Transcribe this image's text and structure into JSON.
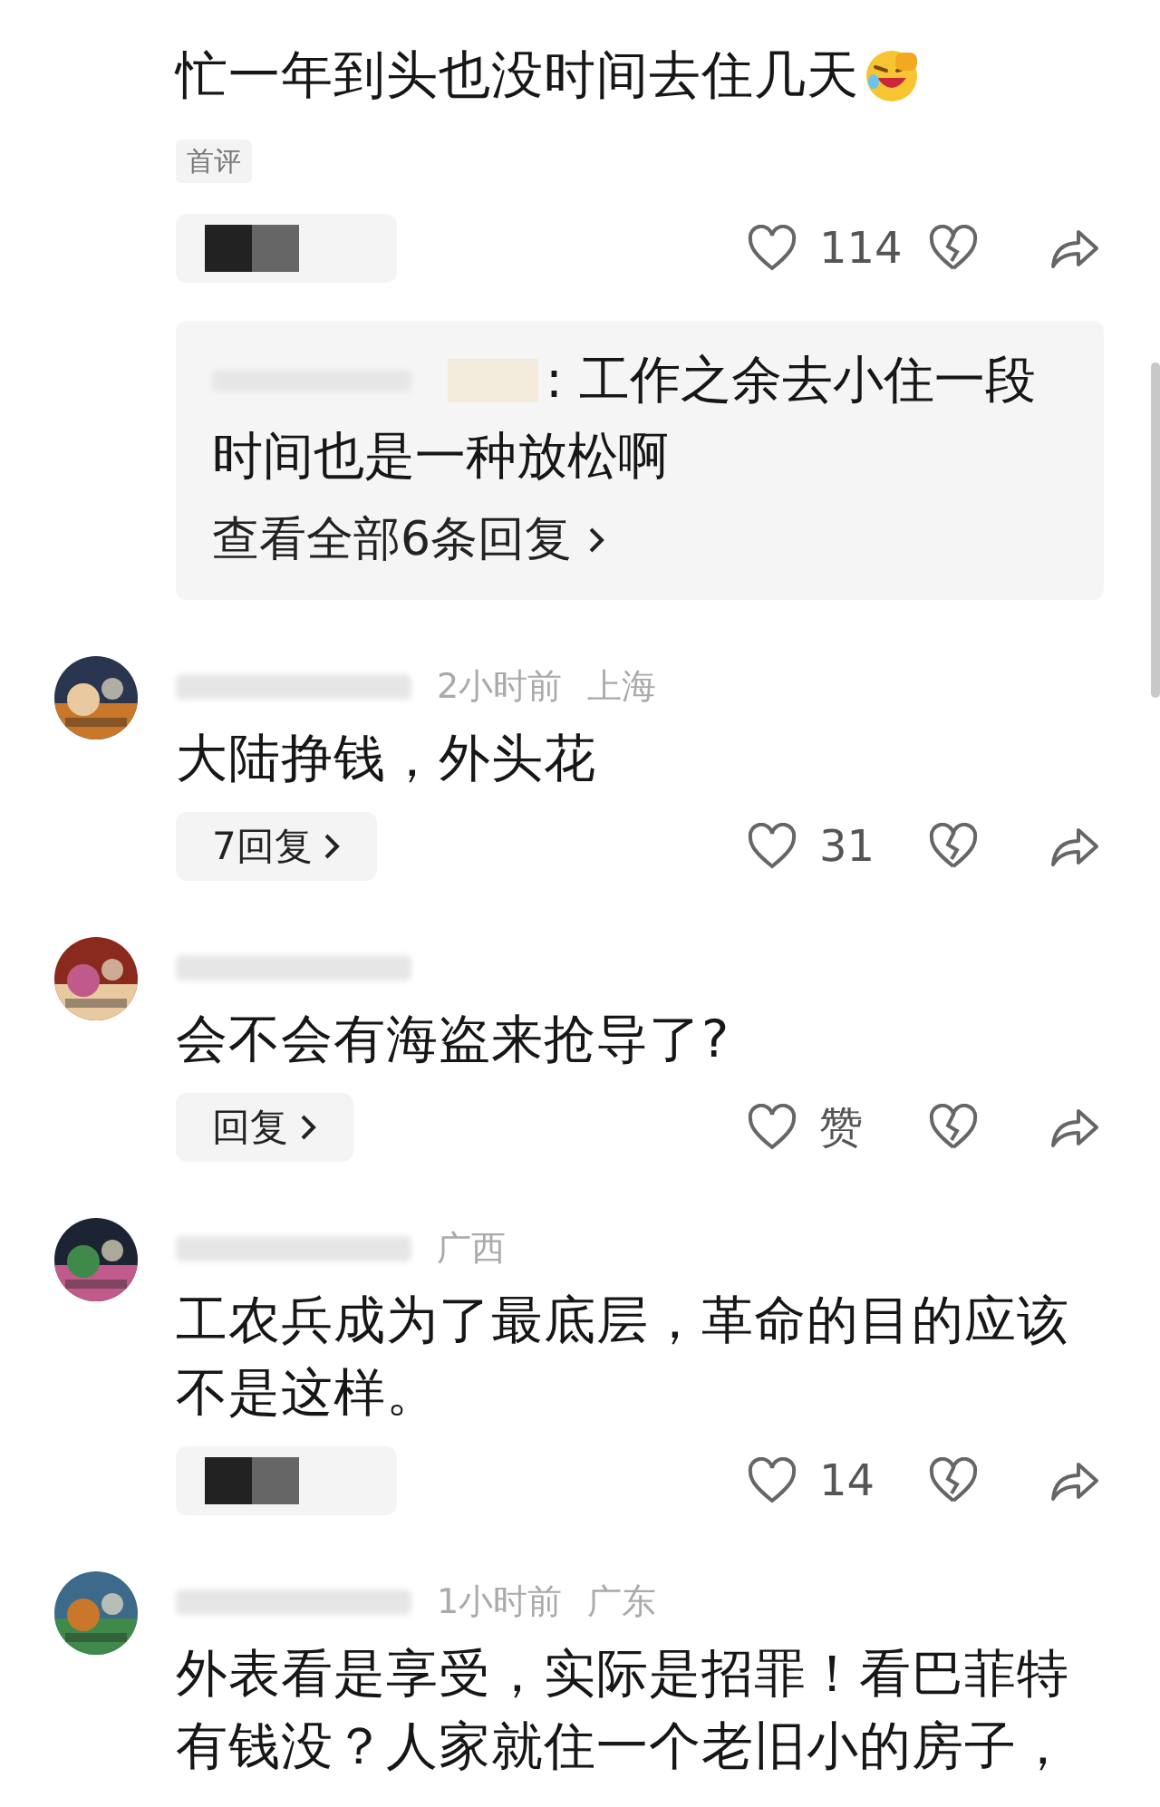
{
  "comments": [
    {
      "text": "忙一年到头也没时间去住几天",
      "emoji": true,
      "tag": "首评",
      "reply": {
        "kind": "redacted"
      },
      "likes": "114",
      "thread": {
        "lines": [
          ": 工作之余去小住一段",
          "时间也是一种放松啊"
        ],
        "more": "查看全部6条回复"
      }
    },
    {
      "avatar": {
        "kind": "picture"
      },
      "meta": [
        {
          "kind": "redacted"
        },
        {
          "kind": "text",
          "text": "2小时前"
        },
        {
          "kind": "text",
          "text": "上海"
        }
      ],
      "text": "大陆挣钱，外头花",
      "reply": {
        "kind": "button",
        "label": "7回复"
      },
      "likes": "31"
    },
    {
      "avatar": {
        "kind": "picture"
      },
      "meta": [
        {
          "kind": "redacted"
        }
      ],
      "text": "会不会有海盗来抢导了?",
      "reply": {
        "kind": "button",
        "label": "回复"
      },
      "likes": "赞"
    },
    {
      "avatar": {
        "kind": "picture"
      },
      "meta": [
        {
          "kind": "redacted"
        },
        {
          "kind": "text",
          "text": "广西"
        }
      ],
      "text": "工农兵成为了最底层，革命的目的应该不是这样。",
      "reply": {
        "kind": "redacted"
      },
      "likes": "14"
    },
    {
      "avatar": {
        "kind": "picture"
      },
      "meta": [
        {
          "kind": "redacted"
        },
        {
          "kind": "text",
          "text": "1小时前"
        },
        {
          "kind": "text",
          "text": "广东"
        }
      ],
      "text": "外表看是享受，实际是招罪！看巴菲特有钱没？人家就住一个老旧小的房子，"
    }
  ]
}
